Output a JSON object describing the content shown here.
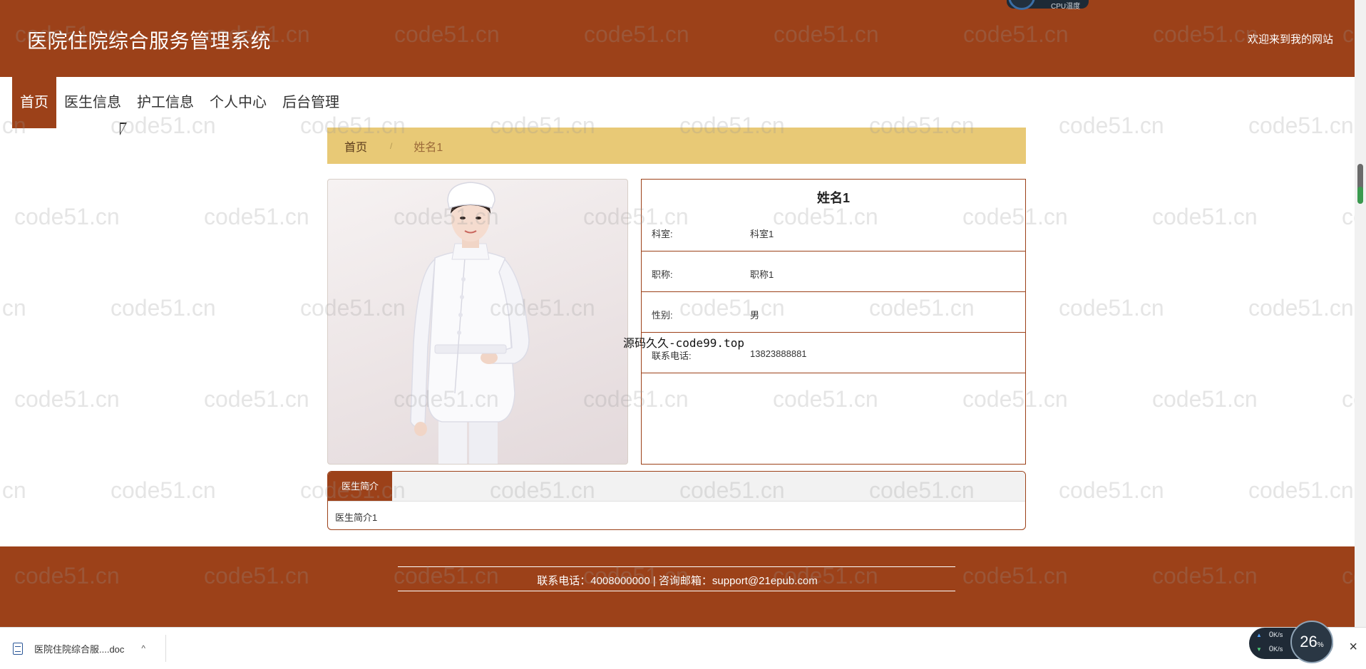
{
  "header": {
    "title": "医院住院综合服务管理系统",
    "welcome": "欢迎来到我的网站",
    "cpu_label": "CPU温度"
  },
  "nav": {
    "items": [
      "首页",
      "医生信息",
      "护工信息",
      "个人中心",
      "后台管理"
    ],
    "active_index": 0
  },
  "breadcrumb": {
    "home": "首页",
    "separator": "/",
    "current": "姓名1"
  },
  "detail": {
    "name": "姓名1",
    "rows": [
      {
        "label": "科室:",
        "value": "科室1"
      },
      {
        "label": "职称:",
        "value": "职称1"
      },
      {
        "label": "性别:",
        "value": "男"
      },
      {
        "label": "联系电话:",
        "value": "13823888881"
      }
    ]
  },
  "photo": {
    "icon": "doctor-photo"
  },
  "overlay": "源码久久-code99.top",
  "intro": {
    "tab_label": "医生简介",
    "content": "医生简介1"
  },
  "footer": {
    "text": "联系电话：4008000000 | 咨询邮箱：support@21epub.com"
  },
  "watermark": "code51.cn",
  "download_bar": {
    "file_name": "医院住院综合服....doc",
    "chevron": "^",
    "close": "×"
  },
  "net_widget": {
    "up": "0",
    "down": "0",
    "unit": "K/s",
    "percent": "26",
    "percent_unit": "%"
  },
  "colors": {
    "brand": "#9c4119",
    "breadcrumb_bg": "#e8c976"
  }
}
